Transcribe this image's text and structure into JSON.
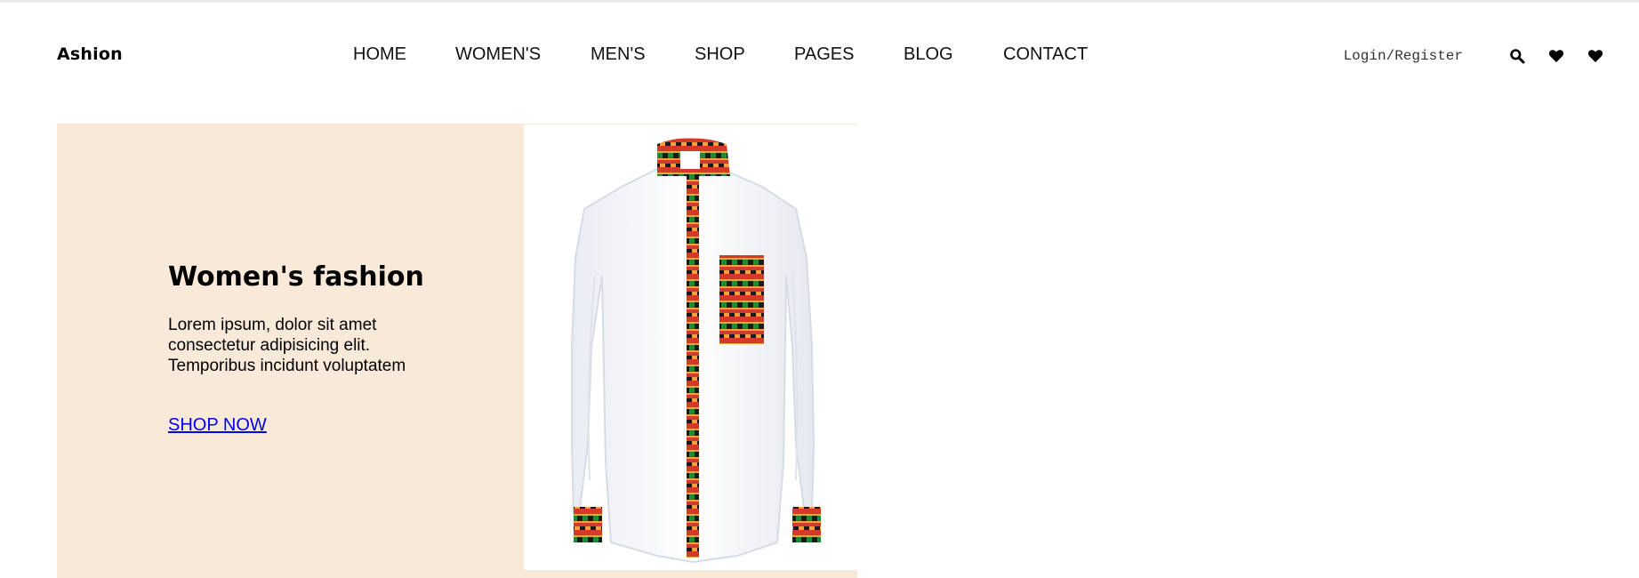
{
  "brand": {
    "logo_text": "Ashion"
  },
  "nav": {
    "items": [
      {
        "label": "HOME"
      },
      {
        "label": "WOMEN'S"
      },
      {
        "label": "MEN'S"
      },
      {
        "label": "SHOP"
      },
      {
        "label": "PAGES"
      },
      {
        "label": "BLOG"
      },
      {
        "label": "CONTACT"
      }
    ]
  },
  "header_right": {
    "login_label": "Login/Register",
    "icons": [
      "search-icon",
      "heart-icon",
      "heart-icon"
    ]
  },
  "hero": {
    "title": "Women's fashion",
    "description": "Lorem ipsum, dolor sit amet consectetur adipisicing elit. Temporibus incidunt voluptatem",
    "cta_label": "SHOP NOW",
    "image_alt": "white shirt with kente print trim",
    "colors": {
      "panel_bg": "#f9e9d8",
      "link": "#0000ee",
      "kente_red": "#d23a2a",
      "kente_orange": "#f2a23a",
      "kente_green": "#1f8a3a",
      "kente_black": "#1a1a1a"
    }
  }
}
